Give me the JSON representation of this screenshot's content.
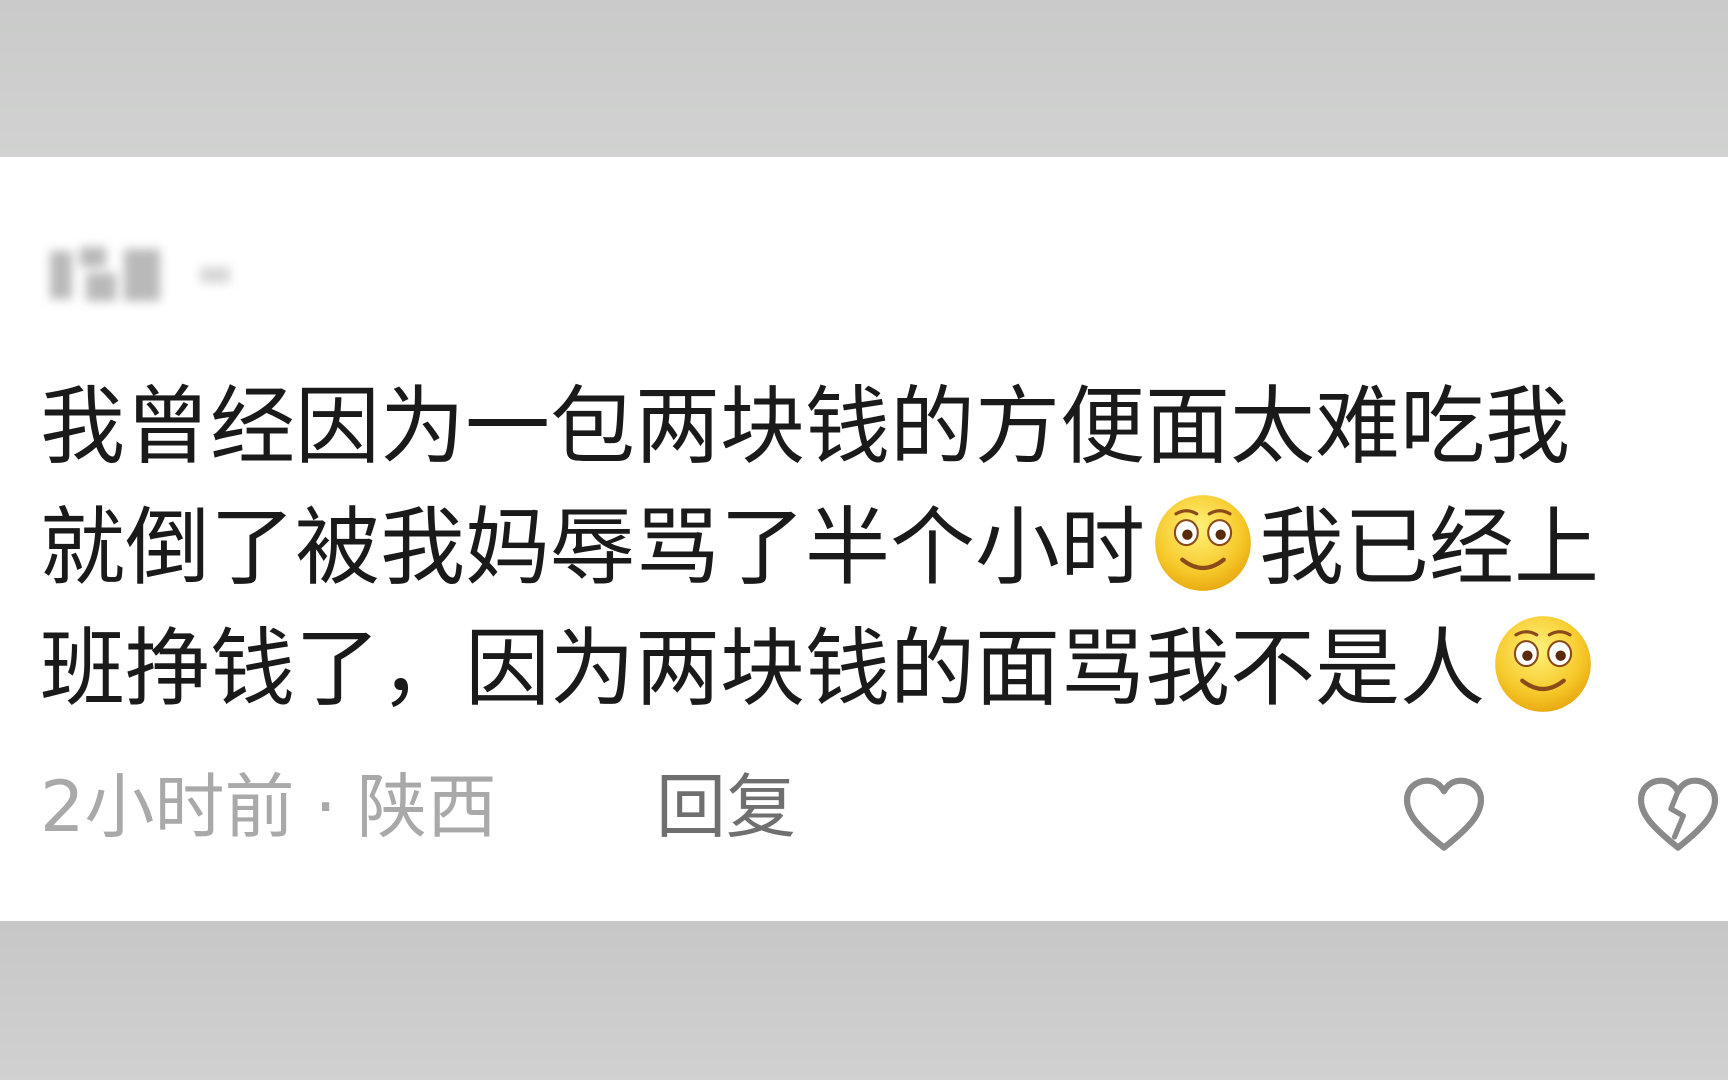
{
  "comment": {
    "username_blurred": true,
    "lines": [
      {
        "before": "我曾经因为一包两块钱的方便面太难吃我",
        "emoji": null,
        "after": ""
      },
      {
        "before": "就倒了被我妈辱骂了半个小时",
        "emoji": "smile-emoji",
        "after": "我已经上"
      },
      {
        "before": "班挣钱了，因为两块钱的面骂我不是人",
        "emoji": "smile-emoji",
        "after": ""
      }
    ],
    "time": "2小时前",
    "separator": "·",
    "location": "陕西",
    "reply_label": "回复",
    "icons": {
      "like": "heart-outline-icon",
      "dislike": "broken-heart-icon"
    }
  },
  "colors": {
    "background_band": "#cfd0cf",
    "card": "#ffffff",
    "text": "#1a1a1a",
    "meta_text": "#a9a9a9",
    "reply_text": "#6f6f6f",
    "icon_stroke": "#8a8a8a"
  }
}
